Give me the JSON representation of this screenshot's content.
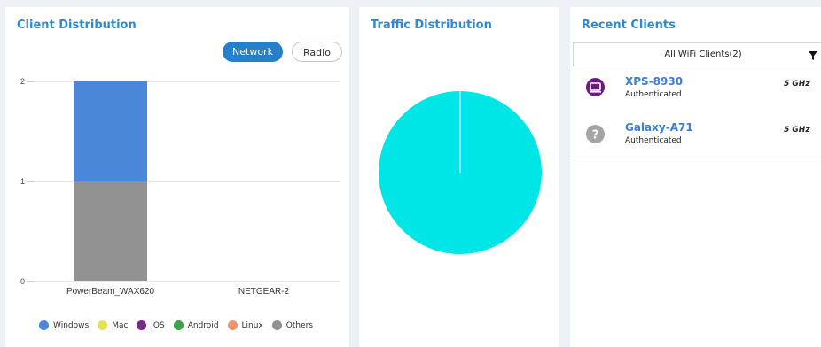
{
  "client_distribution": {
    "title": "Client Distribution",
    "toggle_network": "Network",
    "toggle_radio": "Radio",
    "legend": [
      {
        "label": "Windows",
        "color": "#4a87d9"
      },
      {
        "label": "Mac",
        "color": "#e4e259"
      },
      {
        "label": "iOS",
        "color": "#7a2a8c"
      },
      {
        "label": "Android",
        "color": "#3da14a"
      },
      {
        "label": "Linux",
        "color": "#f29471"
      },
      {
        "label": "Others",
        "color": "#929292"
      }
    ]
  },
  "traffic_distribution": {
    "title": "Traffic Distribution"
  },
  "recent_clients": {
    "title": "Recent Clients",
    "filter_label": "All WiFi Clients(2)",
    "clients": [
      {
        "name": "XPS-8930",
        "status": "Authenticated",
        "band": "5 GHz",
        "icon": "laptop-icon",
        "icon_color": "#6a1b7f"
      },
      {
        "name": "Galaxy-A71",
        "status": "Authenticated",
        "band": "5 GHz",
        "icon": "unknown-device-icon",
        "icon_color": "#a5a5a5"
      }
    ]
  },
  "chart_data": [
    {
      "type": "bar",
      "stacked": true,
      "categories": [
        "PowerBeam_WAX620",
        "NETGEAR-2"
      ],
      "series": [
        {
          "name": "Others",
          "color": "#929292",
          "values": [
            1,
            0
          ]
        },
        {
          "name": "Windows",
          "color": "#4a87d9",
          "values": [
            1,
            0
          ]
        }
      ],
      "ylim": [
        0,
        2
      ],
      "yticks": [
        0,
        1,
        2
      ],
      "grid": true,
      "legend_position": "bottom"
    },
    {
      "type": "pie",
      "slices": [
        {
          "value": 100,
          "color": "#00e6e6"
        }
      ]
    }
  ]
}
